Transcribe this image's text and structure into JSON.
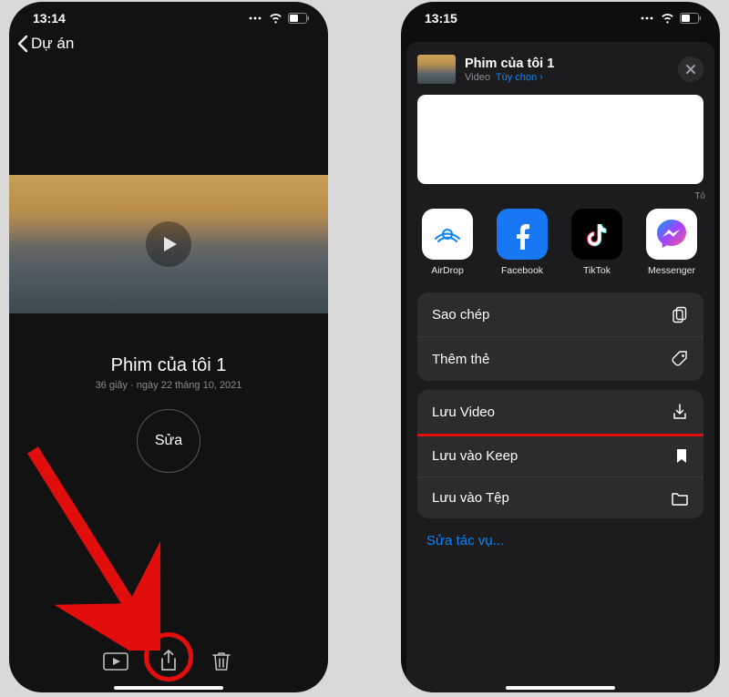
{
  "left": {
    "status_time": "13:14",
    "back_label": "Dự án",
    "movie_title": "Phim của tôi 1",
    "movie_sub": "36 giây · ngày 22 tháng 10, 2021",
    "edit_label": "Sửa"
  },
  "right": {
    "status_time": "13:15",
    "share_title": "Phim của tôi 1",
    "share_type": "Video",
    "share_options": "Tùy chọn",
    "to_label": "Tó",
    "apps": {
      "airdrop": "AirDrop",
      "facebook": "Facebook",
      "tiktok": "TikTok",
      "messenger": "Messenger"
    },
    "actions": {
      "copy": "Sao chép",
      "add_tag": "Thêm thẻ",
      "save_video": "Lưu Video",
      "save_keep": "Lưu vào Keep",
      "save_file": "Lưu vào Tệp"
    },
    "edit_actions": "Sửa tác vụ..."
  }
}
